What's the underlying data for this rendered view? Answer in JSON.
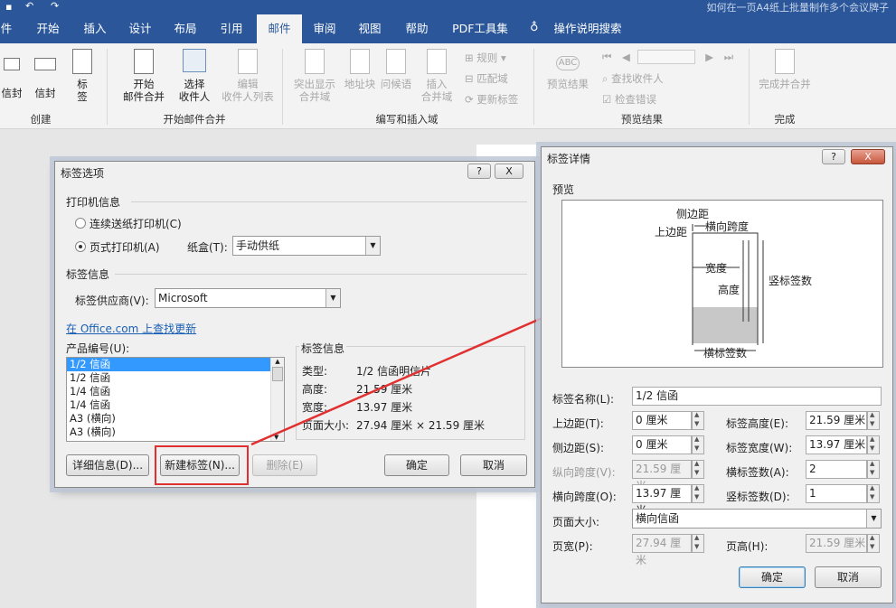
{
  "window": {
    "title": "如何在一页A4纸上批量制作多个会议牌子"
  },
  "tabs": [
    {
      "label": "件"
    },
    {
      "label": "开始"
    },
    {
      "label": "插入"
    },
    {
      "label": "设计"
    },
    {
      "label": "布局"
    },
    {
      "label": "引用"
    },
    {
      "label": "邮件"
    },
    {
      "label": "审阅"
    },
    {
      "label": "视图"
    },
    {
      "label": "帮助"
    },
    {
      "label": "PDF工具集"
    },
    {
      "label": "操作说明搜索"
    }
  ],
  "ribbon": {
    "create": {
      "envelope": "信封",
      "envelope_cut": "信封",
      "label": "标签",
      "group": "创建"
    },
    "start": {
      "start_merge": "开始\n邮件合并",
      "select_recipients": "选择\n收件人",
      "edit_list": "编辑\n收件人列表",
      "group": "开始邮件合并"
    },
    "write": {
      "highlight": "突出显示\n合并域",
      "address": "地址块",
      "greeting": "问候语",
      "insert_field": "插入\n合并域",
      "rules": "规则",
      "match": "匹配域",
      "update": "更新标签",
      "group": "编写和插入域"
    },
    "preview": {
      "preview_results": "预览结果",
      "find_recipient": "查找收件人",
      "check_errors": "检查错误",
      "group": "预览结果"
    },
    "finish": {
      "finish_merge": "完成并合并",
      "group": "完成"
    }
  },
  "label_options": {
    "title": "标签选项",
    "help": "?",
    "close": "X",
    "printer_section": "打印机信息",
    "continuous": "连续送纸打印机(C)",
    "page_printer": "页式打印机(A)",
    "tray_label": "纸盒(T):",
    "tray_value": "手动供纸",
    "label_info_section": "标签信息",
    "vendor_label": "标签供应商(V):",
    "vendor_value": "Microsoft",
    "update_link": "在 Office.com 上查找更新",
    "product_label": "产品编号(U):",
    "products": [
      "1/2 信函",
      "1/2 信函",
      "1/4 信函",
      "1/4 信函",
      "A3 (横向)",
      "A3 (横向)"
    ],
    "info_title": "标签信息",
    "info_type_k": "类型:",
    "info_type_v": "1/2 信函明信片",
    "info_height_k": "高度:",
    "info_height_v": "21.59 厘米",
    "info_width_k": "宽度:",
    "info_width_v": "13.97 厘米",
    "info_page_k": "页面大小:",
    "info_page_v": "27.94 厘米 × 21.59 厘米",
    "btn_details": "详细信息(D)...",
    "btn_new": "新建标签(N)...",
    "btn_delete": "删除(E)",
    "btn_ok": "确定",
    "btn_cancel": "取消"
  },
  "label_details": {
    "title": "标签详情",
    "help": "?",
    "close": "X",
    "preview_label": "预览",
    "diagram": {
      "side_margin": "侧边距",
      "top_margin": "上边距",
      "h_pitch": "横向跨度",
      "width": "宽度",
      "height": "高度",
      "rows": "竖标签数",
      "cols": "横标签数"
    },
    "name_label": "标签名称(L):",
    "name_value": "1/2 信函",
    "top_label": "上边距(T):",
    "top_value": "0 厘米",
    "side_label": "侧边距(S):",
    "side_value": "0 厘米",
    "vpitch_label": "纵向跨度(V):",
    "vpitch_value": "21.59 厘米",
    "hpitch_label": "横向跨度(O):",
    "hpitch_value": "13.97 厘米",
    "lheight_label": "标签高度(E):",
    "lheight_value": "21.59 厘米",
    "lwidth_label": "标签宽度(W):",
    "lwidth_value": "13.97 厘米",
    "across_label": "横标签数(A):",
    "across_value": "2",
    "down_label": "竖标签数(D):",
    "down_value": "1",
    "pagesize_label": "页面大小:",
    "pagesize_value": "横向信函",
    "pwidth_label": "页宽(P):",
    "pwidth_value": "27.94 厘米",
    "pheight_label": "页高(H):",
    "pheight_value": "21.59 厘米",
    "btn_ok": "确定",
    "btn_cancel": "取消"
  },
  "colors": {
    "accent": "#2b579a",
    "highlight_box": "#e03030"
  }
}
